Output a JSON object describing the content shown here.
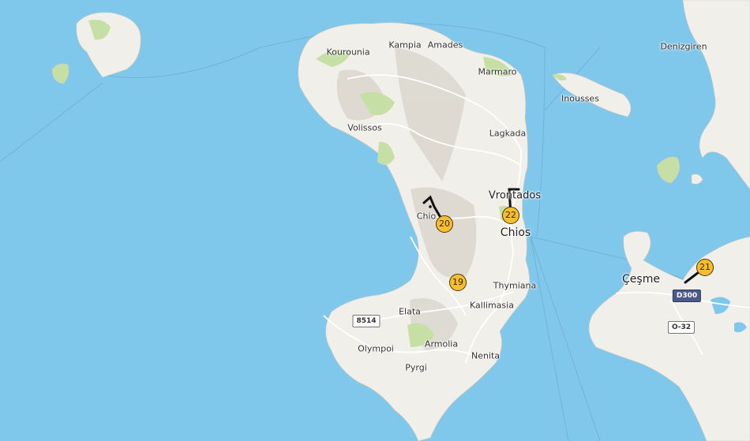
{
  "map": {
    "colors": {
      "sea": "#7fc8ec",
      "land": "#f1efe9",
      "park": "#c6dfa5",
      "hill": "#d9d5cb",
      "marker": "#f6bd32",
      "track": "#111111"
    },
    "places": {
      "kourounia": "Kourounia",
      "kampia": "Kampia",
      "amades": "Amades",
      "marmaro": "Marmaro",
      "volissos": "Volissos",
      "lagkada": "Lagkada",
      "vrontados": "Vrontados",
      "chio_west": "Chio",
      "chios": "Chios",
      "thymiana": "Thymiana",
      "kallimasia": "Kallimasia",
      "elata": "Elata",
      "armolia": "Armolia",
      "olympoi": "Olympoi",
      "pyrgi": "Pyrgi",
      "nenita": "Nenita",
      "inousses": "Inousses",
      "denizgiren": "Denizgiren",
      "cesme": "Çeşme"
    },
    "road_shields": {
      "r8514": "8514",
      "d300": "D300",
      "o32": "O-32"
    },
    "markers": [
      {
        "id": "marker-19",
        "label": "19"
      },
      {
        "id": "marker-20",
        "label": "20"
      },
      {
        "id": "marker-21",
        "label": "21"
      },
      {
        "id": "marker-22",
        "label": "22"
      }
    ]
  }
}
